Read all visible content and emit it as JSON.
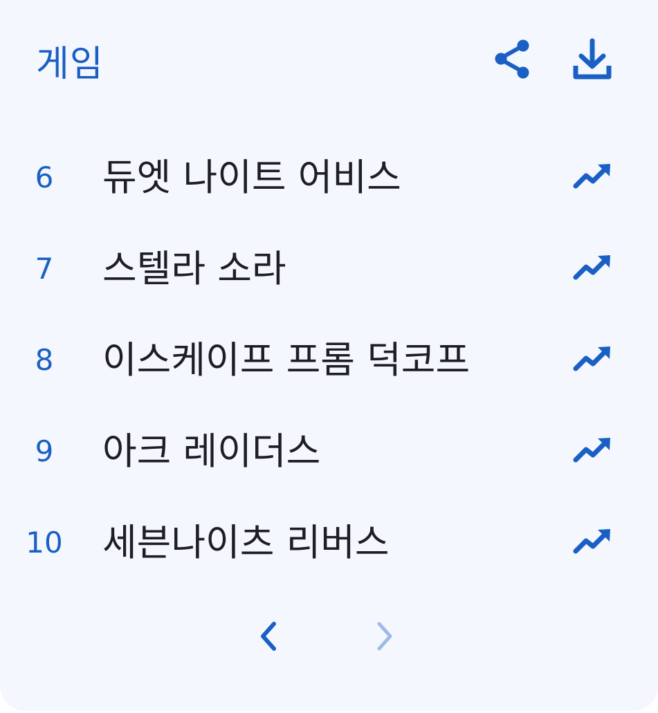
{
  "header": {
    "title": "게임",
    "share_icon": "share-icon",
    "download_icon": "download-icon"
  },
  "list": {
    "items": [
      {
        "rank": "6",
        "name": "듀엣 나이트 어비스",
        "trend_icon": "trending-up-icon"
      },
      {
        "rank": "7",
        "name": "스텔라 소라",
        "trend_icon": "trending-up-icon"
      },
      {
        "rank": "8",
        "name": "이스케이프 프롬 덕코프",
        "trend_icon": "trending-up-icon"
      },
      {
        "rank": "9",
        "name": "아크 레이더스",
        "trend_icon": "trending-up-icon"
      },
      {
        "rank": "10",
        "name": "세븐나이츠 리버스",
        "trend_icon": "trending-up-icon"
      }
    ]
  },
  "pagination": {
    "prev_icon": "chevron-left-icon",
    "next_icon": "chevron-right-icon",
    "prev_enabled": true,
    "next_enabled": false
  },
  "colors": {
    "accent": "#1a5fc4",
    "accent_disabled": "#9dbbe6",
    "background": "#f4f7fd",
    "text": "#1d1f24"
  }
}
